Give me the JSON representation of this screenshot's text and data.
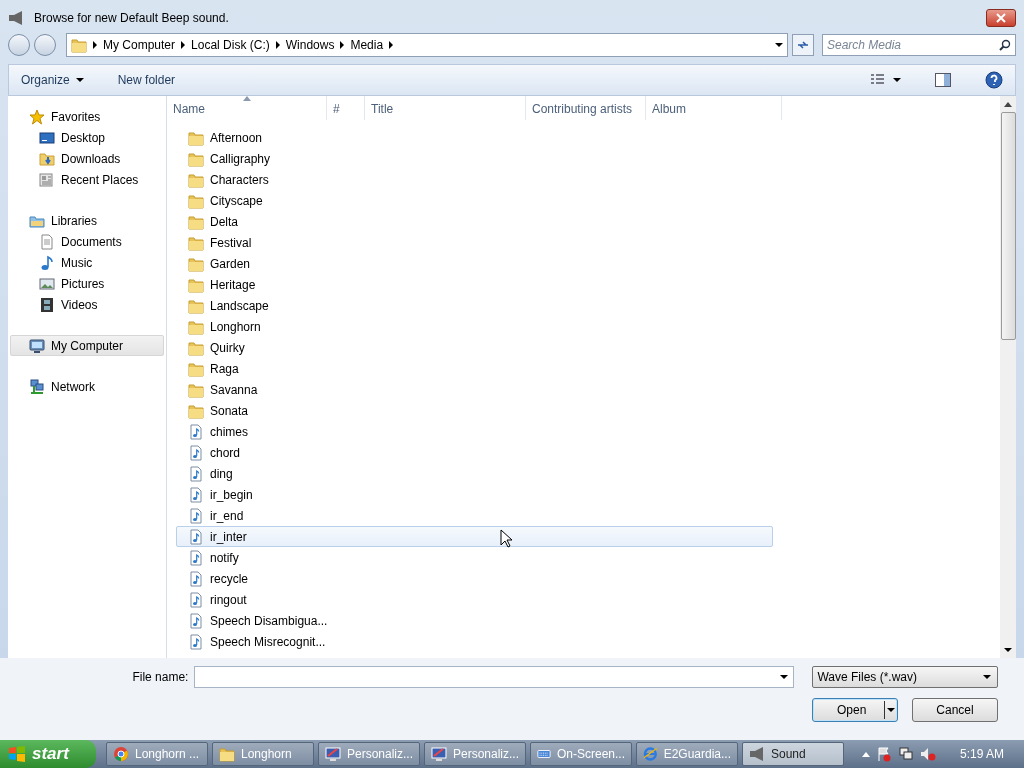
{
  "window": {
    "title": "Browse for new Default Beep sound."
  },
  "address_bar": {
    "crumbs": [
      "My Computer",
      "Local Disk (C:)",
      "Windows",
      "Media"
    ]
  },
  "search": {
    "placeholder": "Search Media"
  },
  "toolbar": {
    "organize": "Organize",
    "new_folder": "New folder"
  },
  "sidebar": {
    "groups": [
      {
        "label": "Favorites",
        "kind": "star",
        "selected": false,
        "children": [
          {
            "label": "Desktop",
            "kind": "desktop",
            "selected": false
          },
          {
            "label": "Downloads",
            "kind": "downloads",
            "selected": false
          },
          {
            "label": "Recent Places",
            "kind": "recent",
            "selected": false
          }
        ]
      },
      {
        "label": "Libraries",
        "kind": "library",
        "selected": false,
        "children": [
          {
            "label": "Documents",
            "kind": "documents",
            "selected": false
          },
          {
            "label": "Music",
            "kind": "music",
            "selected": false
          },
          {
            "label": "Pictures",
            "kind": "pictures",
            "selected": false
          },
          {
            "label": "Videos",
            "kind": "videos",
            "selected": false
          }
        ]
      },
      {
        "label": "My Computer",
        "kind": "computer",
        "selected": true
      },
      {
        "label": "Network",
        "kind": "network",
        "selected": false
      }
    ]
  },
  "table": {
    "columns": [
      {
        "label": "Name",
        "sorted": true
      },
      {
        "label": "#",
        "sorted": false
      },
      {
        "label": "Title",
        "sorted": false
      },
      {
        "label": "Contributing artists",
        "sorted": false
      },
      {
        "label": "Album",
        "sorted": false
      }
    ],
    "rows": [
      {
        "name": "Afternoon",
        "kind": "folder",
        "hovered": false
      },
      {
        "name": "Calligraphy",
        "kind": "folder",
        "hovered": false
      },
      {
        "name": "Characters",
        "kind": "folder",
        "hovered": false
      },
      {
        "name": "Cityscape",
        "kind": "folder",
        "hovered": false
      },
      {
        "name": "Delta",
        "kind": "folder",
        "hovered": false
      },
      {
        "name": "Festival",
        "kind": "folder",
        "hovered": false
      },
      {
        "name": "Garden",
        "kind": "folder",
        "hovered": false
      },
      {
        "name": "Heritage",
        "kind": "folder",
        "hovered": false
      },
      {
        "name": "Landscape",
        "kind": "folder",
        "hovered": false
      },
      {
        "name": "Longhorn",
        "kind": "folder",
        "hovered": false
      },
      {
        "name": "Quirky",
        "kind": "folder",
        "hovered": false
      },
      {
        "name": "Raga",
        "kind": "folder",
        "hovered": false
      },
      {
        "name": "Savanna",
        "kind": "folder",
        "hovered": false
      },
      {
        "name": "Sonata",
        "kind": "folder",
        "hovered": false
      },
      {
        "name": "chimes",
        "kind": "audio",
        "hovered": false
      },
      {
        "name": "chord",
        "kind": "audio",
        "hovered": false
      },
      {
        "name": "ding",
        "kind": "audio",
        "hovered": false
      },
      {
        "name": "ir_begin",
        "kind": "audio",
        "hovered": false
      },
      {
        "name": "ir_end",
        "kind": "audio",
        "hovered": false
      },
      {
        "name": "ir_inter",
        "kind": "audio",
        "hovered": true
      },
      {
        "name": "notify",
        "kind": "audio",
        "hovered": false
      },
      {
        "name": "recycle",
        "kind": "audio",
        "hovered": false
      },
      {
        "name": "ringout",
        "kind": "audio",
        "hovered": false
      },
      {
        "name": "Speech Disambigua...",
        "kind": "audio",
        "hovered": false
      },
      {
        "name": "Speech Misrecognit...",
        "kind": "audio",
        "hovered": false
      }
    ]
  },
  "file_name": {
    "label": "File name:"
  },
  "file_type": {
    "value": "Wave Files (*.wav)"
  },
  "buttons": [
    {
      "label": "Open",
      "kind": "split"
    },
    {
      "label": "Cancel",
      "kind": "plain"
    }
  ],
  "taskbar": {
    "start": "start",
    "buttons": [
      {
        "label": "Longhorn ...",
        "kind": "chrome",
        "selected": false
      },
      {
        "label": "Longhorn",
        "kind": "folder",
        "selected": false
      },
      {
        "label": "Personaliz...",
        "kind": "personalize",
        "selected": false
      },
      {
        "label": "Personaliz...",
        "kind": "personalize",
        "selected": false
      },
      {
        "label": "On-Screen...",
        "kind": "keyboard",
        "selected": false
      },
      {
        "label": "E2Guardia...",
        "kind": "ie",
        "selected": false
      },
      {
        "label": "Sound",
        "kind": "speaker",
        "selected": true
      }
    ],
    "clock": "5:19 AM"
  }
}
